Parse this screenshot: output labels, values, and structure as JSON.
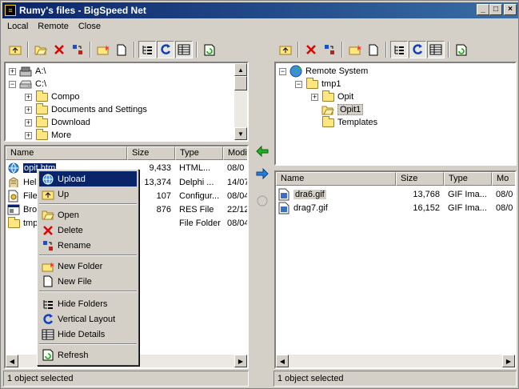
{
  "window": {
    "title": "Rumy's files - BigSpeed Net"
  },
  "menu": [
    "Local",
    "Remote",
    "Close"
  ],
  "local": {
    "tree": [
      {
        "label": "A:\\",
        "icon": "floppy-drive-icon"
      },
      {
        "label": "C:\\",
        "icon": "hard-drive-icon"
      },
      {
        "label": "Compo",
        "icon": "folder-icon"
      },
      {
        "label": "Documents and Settings",
        "icon": "folder-icon"
      },
      {
        "label": "Download",
        "icon": "folder-icon"
      },
      {
        "label": "More",
        "icon": "folder-icon"
      }
    ],
    "columns": [
      "Name",
      "Size",
      "Type",
      "Modi"
    ],
    "rows": [
      {
        "name": "opit.htm",
        "size": "9,433",
        "type": "HTML...",
        "modified": "08/0"
      },
      {
        "name": "Help",
        "size": "13,374",
        "type": "Delphi ...",
        "modified": "14/07"
      },
      {
        "name": "File",
        "size": "107",
        "type": "Configur...",
        "modified": "08/04"
      },
      {
        "name": "Brow",
        "size": "876",
        "type": "RES File",
        "modified": "22/12"
      },
      {
        "name": "tmp",
        "size": "",
        "type": "File Folder",
        "modified": "08/04"
      }
    ],
    "status": "1 object selected"
  },
  "remote": {
    "tree": [
      {
        "label": "Remote System",
        "icon": "globe-icon"
      },
      {
        "label": "tmp1",
        "icon": "folder-icon"
      },
      {
        "label": "Opit",
        "icon": "folder-icon"
      },
      {
        "label": "Opit1",
        "icon": "folder-open-icon"
      },
      {
        "label": "Templates",
        "icon": "folder-icon"
      }
    ],
    "columns": [
      "Name",
      "Size",
      "Type",
      "Mo"
    ],
    "rows": [
      {
        "name": "dra6.gif",
        "size": "13,768",
        "type": "GIF Ima...",
        "modified": "08/0"
      },
      {
        "name": "drag7.gif",
        "size": "16,152",
        "type": "GIF Ima...",
        "modified": "08/0"
      }
    ],
    "status": "1 object selected"
  },
  "context_menu": {
    "items": [
      "Upload",
      "Up",
      "Open",
      "Delete",
      "Rename",
      "New Folder",
      "New File",
      "Hide Folders",
      "Vertical Layout",
      "Hide Details",
      "Refresh"
    ],
    "selected": "Upload"
  },
  "colors": {
    "title_start": "#0a246a",
    "title_end": "#3a6ea5",
    "selection": "#0a246a",
    "arrow_green": "#20b020",
    "arrow_blue": "#2080e0"
  }
}
